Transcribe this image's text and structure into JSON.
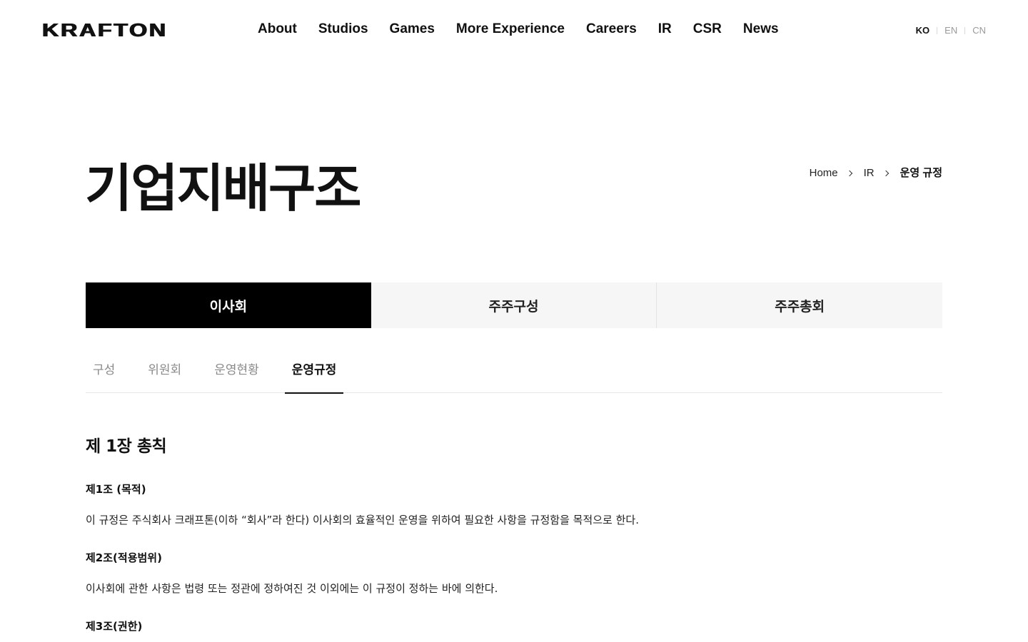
{
  "header": {
    "logo": "KRAFTON",
    "nav": [
      "About",
      "Studios",
      "Games",
      "More Experience",
      "Careers",
      "IR",
      "CSR",
      "News"
    ],
    "languages": [
      "KO",
      "EN",
      "CN"
    ],
    "active_language": "KO"
  },
  "page": {
    "title": "기업지배구조",
    "breadcrumb": [
      "Home",
      "IR",
      "운영 규정"
    ]
  },
  "main_tabs": {
    "items": [
      "이사회",
      "주주구성",
      "주주총회"
    ],
    "active": "이사회"
  },
  "sub_tabs": {
    "items": [
      "구성",
      "위원회",
      "운영현황",
      "운영규정"
    ],
    "active": "운영규정"
  },
  "content": {
    "chapter": "제 1장 총칙",
    "articles": [
      {
        "title": "제1조 (목적)",
        "body": "이 규정은 주식회사 크래프톤(이하 “회사”라 한다) 이사회의 효율적인 운영을 위하여 필요한 사항을 규정함을 목적으로 한다."
      },
      {
        "title": "제2조(적용범위)",
        "body": "이사회에 관한 사항은 법령 또는 정관에 정하여진 것 이외에는 이 규정이 정하는 바에 의한다."
      },
      {
        "title": "제3조(권한)"
      }
    ]
  }
}
